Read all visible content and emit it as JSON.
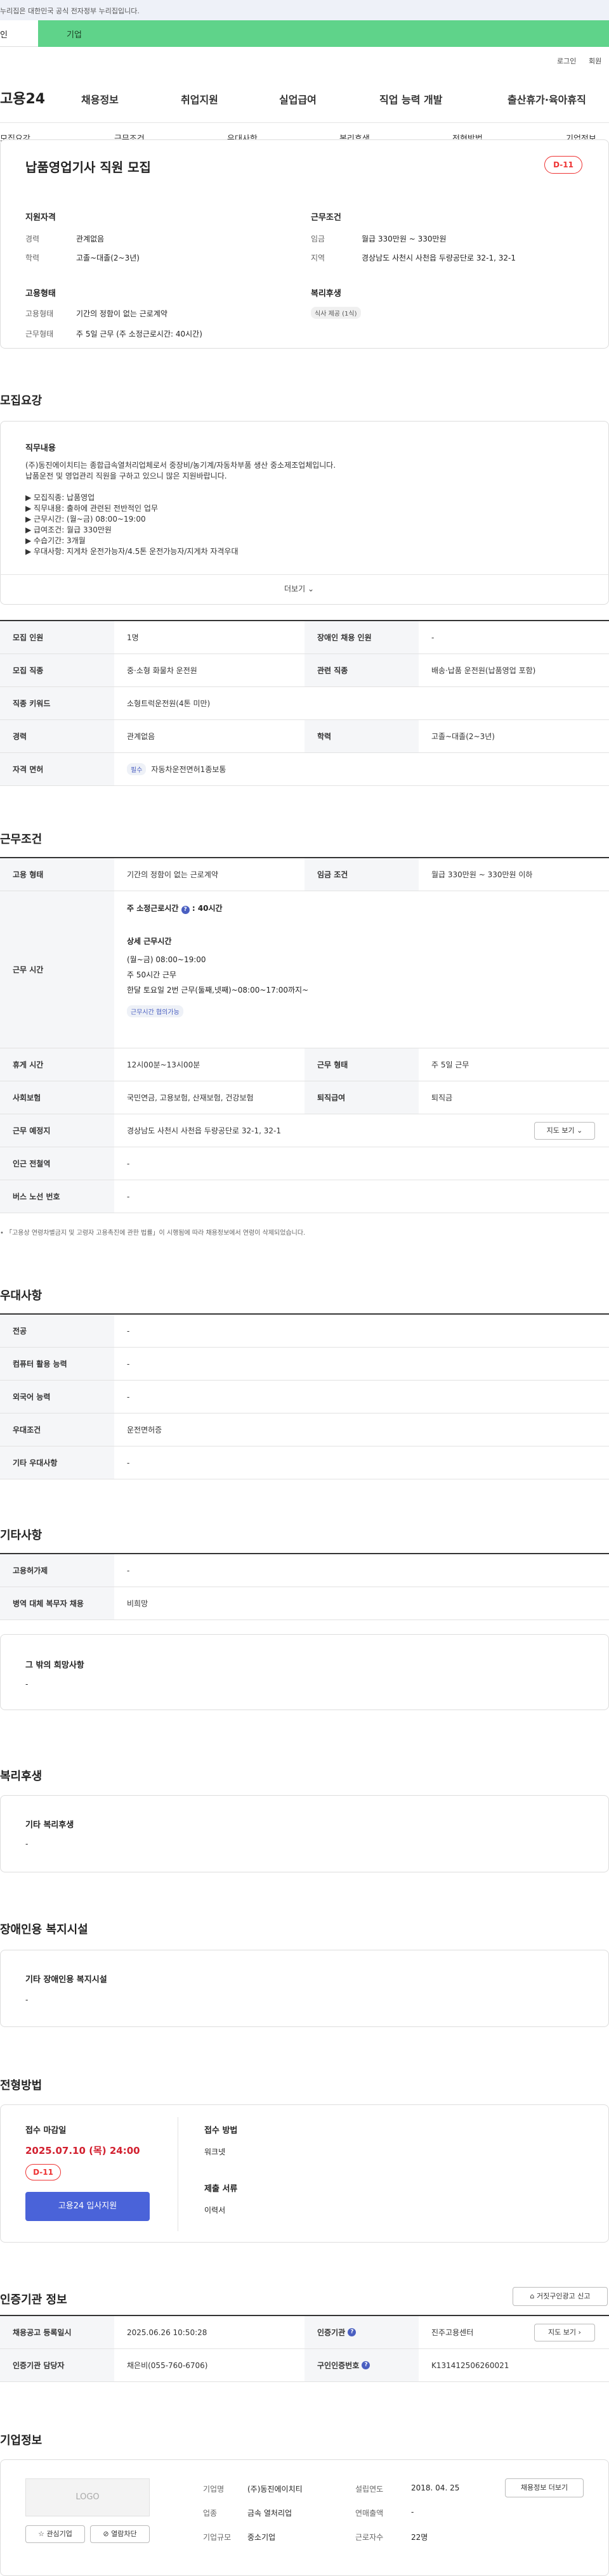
{
  "top_notice": "누리집은 대한민국 공식 전자정부 누리집입니다.",
  "site_tabs": [
    "인",
    "기업"
  ],
  "util": {
    "login": "로그인",
    "join": "회원"
  },
  "logo": "고용24",
  "gnb": [
    "채용정보",
    "취업지원",
    "실업급여",
    "직업 능력 개발",
    "출산휴가·육아휴직"
  ],
  "snb": [
    "모집요강",
    "근무조건",
    "우대사항",
    "복리후생",
    "전형방법",
    "기업정보"
  ],
  "job": {
    "title": "납품영업기사 직원 모집",
    "dday": "D-11",
    "qual_title": "지원자격",
    "career_k": "경력",
    "career_v": "관계없음",
    "edu_k": "학력",
    "edu_v": "고졸~대졸(2~3년)",
    "emp_title": "고용형태",
    "emptype_k": "고용형태",
    "emptype_v": "기간의 정함이 없는 근로계약",
    "worktype_k": "근무형태",
    "worktype_v": "주 5일 근무 (주 소정근로시간: 40시간)",
    "cond_title": "근무조건",
    "wage_k": "임금",
    "wage_v": "월급 330만원 ~ 330만원",
    "loc_k": "지역",
    "loc_v": "경상남도 사천시 사천읍 두량공단로 32-1, 32-1",
    "welfare_title": "복리후생",
    "welfare_tag": "식사 제공 (1식)"
  },
  "recruit": {
    "title": "모집요강",
    "content_title": "직무내용",
    "lines": [
      "(주)동진에이치티는 종합급속열처리업체로서 중장비/농기계/자동차부품 생산 중소제조업체입니다.",
      "납품운전 및 영업관리 직원을 구하고 있으니 많은 지원바랍니다.",
      "",
      "▶ 모집직종: 납품영업",
      "▶ 직무내용: 출하에 관련된 전반적인 업무",
      "▶ 근무시간: (월~금) 08:00~19:00",
      "▶ 급여조건: 월급 330만원",
      "▶ 수습기간: 3개월",
      "▶ 우대사항: 지게차 운전가능자/4.5톤 운전가능자/지게차 자격우대"
    ],
    "more": "더보기",
    "rows": [
      [
        "모집 인원",
        "1명",
        "장애인 채용 인원",
        "-"
      ],
      [
        "모집 직종",
        "중·소형 화물차 운전원",
        "관련 직종",
        "배송·납품 운전원(납품영업 포함)"
      ],
      [
        "직종 키워드",
        "소형트럭운전원(4톤 미만)",
        "",
        ""
      ],
      [
        "경력",
        "관계없음",
        "학력",
        "고졸~대졸(2~3년)"
      ]
    ],
    "license_k": "자격 면허",
    "license_tag": "필수",
    "license_v": "자동차운전면허1종보통"
  },
  "work": {
    "title": "근무조건",
    "row1": [
      "고용 형태",
      "기간의 정함이 없는 근로계약",
      "임금 조건",
      "월급 330만원 ~ 330만원 이하"
    ],
    "time_k": "근무 시간",
    "time_main": "주 소정근로시간",
    "time_hours": "40시간",
    "detail_title": "상세 근무시간",
    "detail": [
      "(월~금) 08:00~19:00",
      "주 50시간 근무",
      "한달 토요일 2번 근무(둘째,넷째)~08:00~17:00까지~"
    ],
    "detail_tag": "근무시간 협의가능",
    "rows": [
      [
        "휴게 시간",
        "12시00분~13시00분",
        "근무 형태",
        "주 5일 근무"
      ],
      [
        "사회보험",
        "국민연금, 고용보험, 산재보험, 건강보험",
        "퇴직급여",
        "퇴직금"
      ]
    ],
    "place_k": "근무 예정지",
    "place_v": "경상남도 사천시 사천읍 두량공단로 32-1, 32-1",
    "map_btn": "지도 보기",
    "subway_k": "인근 전철역",
    "subway_v": "-",
    "bus_k": "버스 노선 번호",
    "bus_v": "-",
    "note": "「고용상 연령차별금지 및 고령자 고용촉진에 관한 법률」이 시행됨에 따라 채용정보에서 연령이 삭제되었습니다."
  },
  "pref": {
    "title": "우대사항",
    "rows": [
      [
        "전공",
        "-"
      ],
      [
        "컴퓨터 활용 능력",
        "-"
      ],
      [
        "외국어 능력",
        "-"
      ],
      [
        "우대조건",
        "운전면허증"
      ],
      [
        "기타 우대사항",
        "-"
      ]
    ]
  },
  "etc": {
    "title": "기타사항",
    "rows": [
      [
        "고용허가제",
        "-"
      ],
      [
        "병역 대체 복무자 채용",
        "비희망"
      ]
    ],
    "other_title": "그 밖의 희망사항",
    "other_v": "-"
  },
  "welfare": {
    "title": "복리후생",
    "box_title": "기타 복리후생",
    "box_v": "-"
  },
  "disabled": {
    "title": "장애인용 복지시설",
    "box_title": "기타 장애인용 복지시설",
    "box_v": "-"
  },
  "process": {
    "title": "전형방법",
    "deadline_k": "접수 마감일",
    "deadline_v": "2025.07.10 (목) 24:00",
    "dday": "D-11",
    "apply_btn": "고용24 입사지원",
    "method_k": "접수 방법",
    "method_v": "워크넷",
    "docs_k": "제출 서류",
    "docs_v": "이력서"
  },
  "cert": {
    "title": "인증기관 정보",
    "report_btn": "거짓구인광고 신고",
    "row1": [
      "채용공고 등록일시",
      "2025.06.26 10:50:28",
      "인증기관",
      "진주고용센터"
    ],
    "row2": [
      "인증기관 담당자",
      "채은비(055-760-6706)",
      "구인인증번호",
      "K131412506260021"
    ],
    "map_btn": "지도 보기"
  },
  "company": {
    "title": "기업정보",
    "logo": "LOGO",
    "fav": "관심기업",
    "block": "열람차단",
    "recruit_btn": "채용정보 더보기",
    "rows": [
      [
        "기업명",
        "(주)동진에이치티",
        "설립연도",
        "2018. 04. 25"
      ],
      [
        "업종",
        "금속 열처리업",
        "연매출액",
        "-"
      ],
      [
        "기업규모",
        "중소기업",
        "근로자수",
        "22명"
      ]
    ]
  }
}
